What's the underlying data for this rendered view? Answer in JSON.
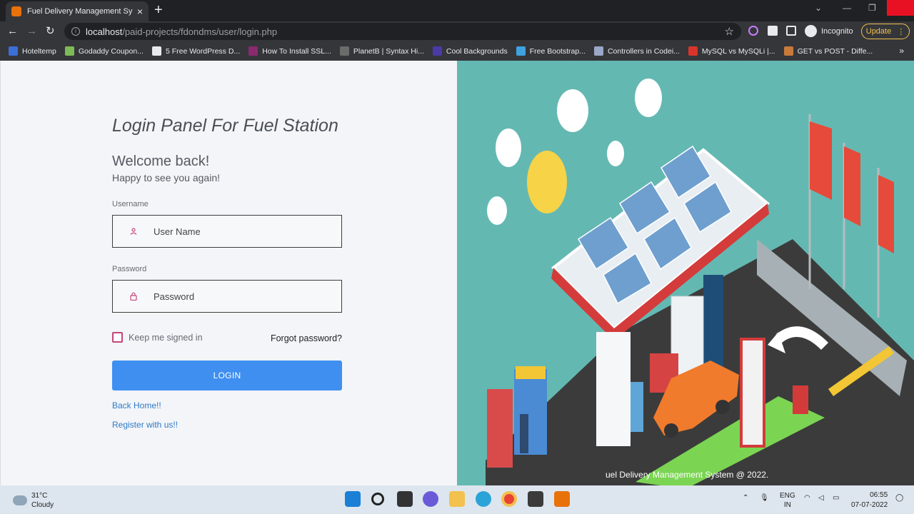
{
  "browser": {
    "tab_title": "Fuel Delivery Management Syste",
    "url_host": "localhost",
    "url_path": "/paid-projects/fdondms/user/login.php",
    "incognito_label": "Incognito",
    "update_label": "Update",
    "bookmarks": [
      {
        "label": "Hoteltemp",
        "color": "#3b6fd6"
      },
      {
        "label": "Godaddy Coupon...",
        "color": "#7dbb57"
      },
      {
        "label": "5 Free WordPress D...",
        "color": "#e8eaed"
      },
      {
        "label": "How To Install SSL...",
        "color": "#8a2a6e"
      },
      {
        "label": "PlanetB | Syntax Hi...",
        "color": "#6b6b6b"
      },
      {
        "label": "Cool Backgrounds",
        "color": "#4a3aa8"
      },
      {
        "label": "Free Bootstrap...",
        "color": "#3fa3e0"
      },
      {
        "label": "Controllers in Codei...",
        "color": "#9aa8c8"
      },
      {
        "label": "MySQL vs MySQLi |...",
        "color": "#d9342b"
      },
      {
        "label": "GET vs POST - Diffe...",
        "color": "#c77a3a"
      }
    ]
  },
  "login": {
    "panel_title": "Login Panel For Fuel Station",
    "welcome": "Welcome back!",
    "subtitle": "Happy to see you again!",
    "username_label": "Username",
    "username_placeholder": "User Name",
    "password_label": "Password",
    "password_placeholder": "Password",
    "remember_label": "Keep me signed in",
    "forgot_label": "Forgot password?",
    "login_button": "LOGIN",
    "back_home": "Back Home!!",
    "register": "Register with us!!"
  },
  "footer": {
    "text": "uel Delivery Management System @ 2022."
  },
  "taskbar": {
    "temperature": "31°C",
    "weather": "Cloudy",
    "lang_top": "ENG",
    "lang_bottom": "IN",
    "time": "06:55",
    "date": "07-07-2022"
  },
  "colors": {
    "accent": "#3f8ff0",
    "illustration_bg": "#64b8b2",
    "checkbox_border": "#c2477b"
  }
}
